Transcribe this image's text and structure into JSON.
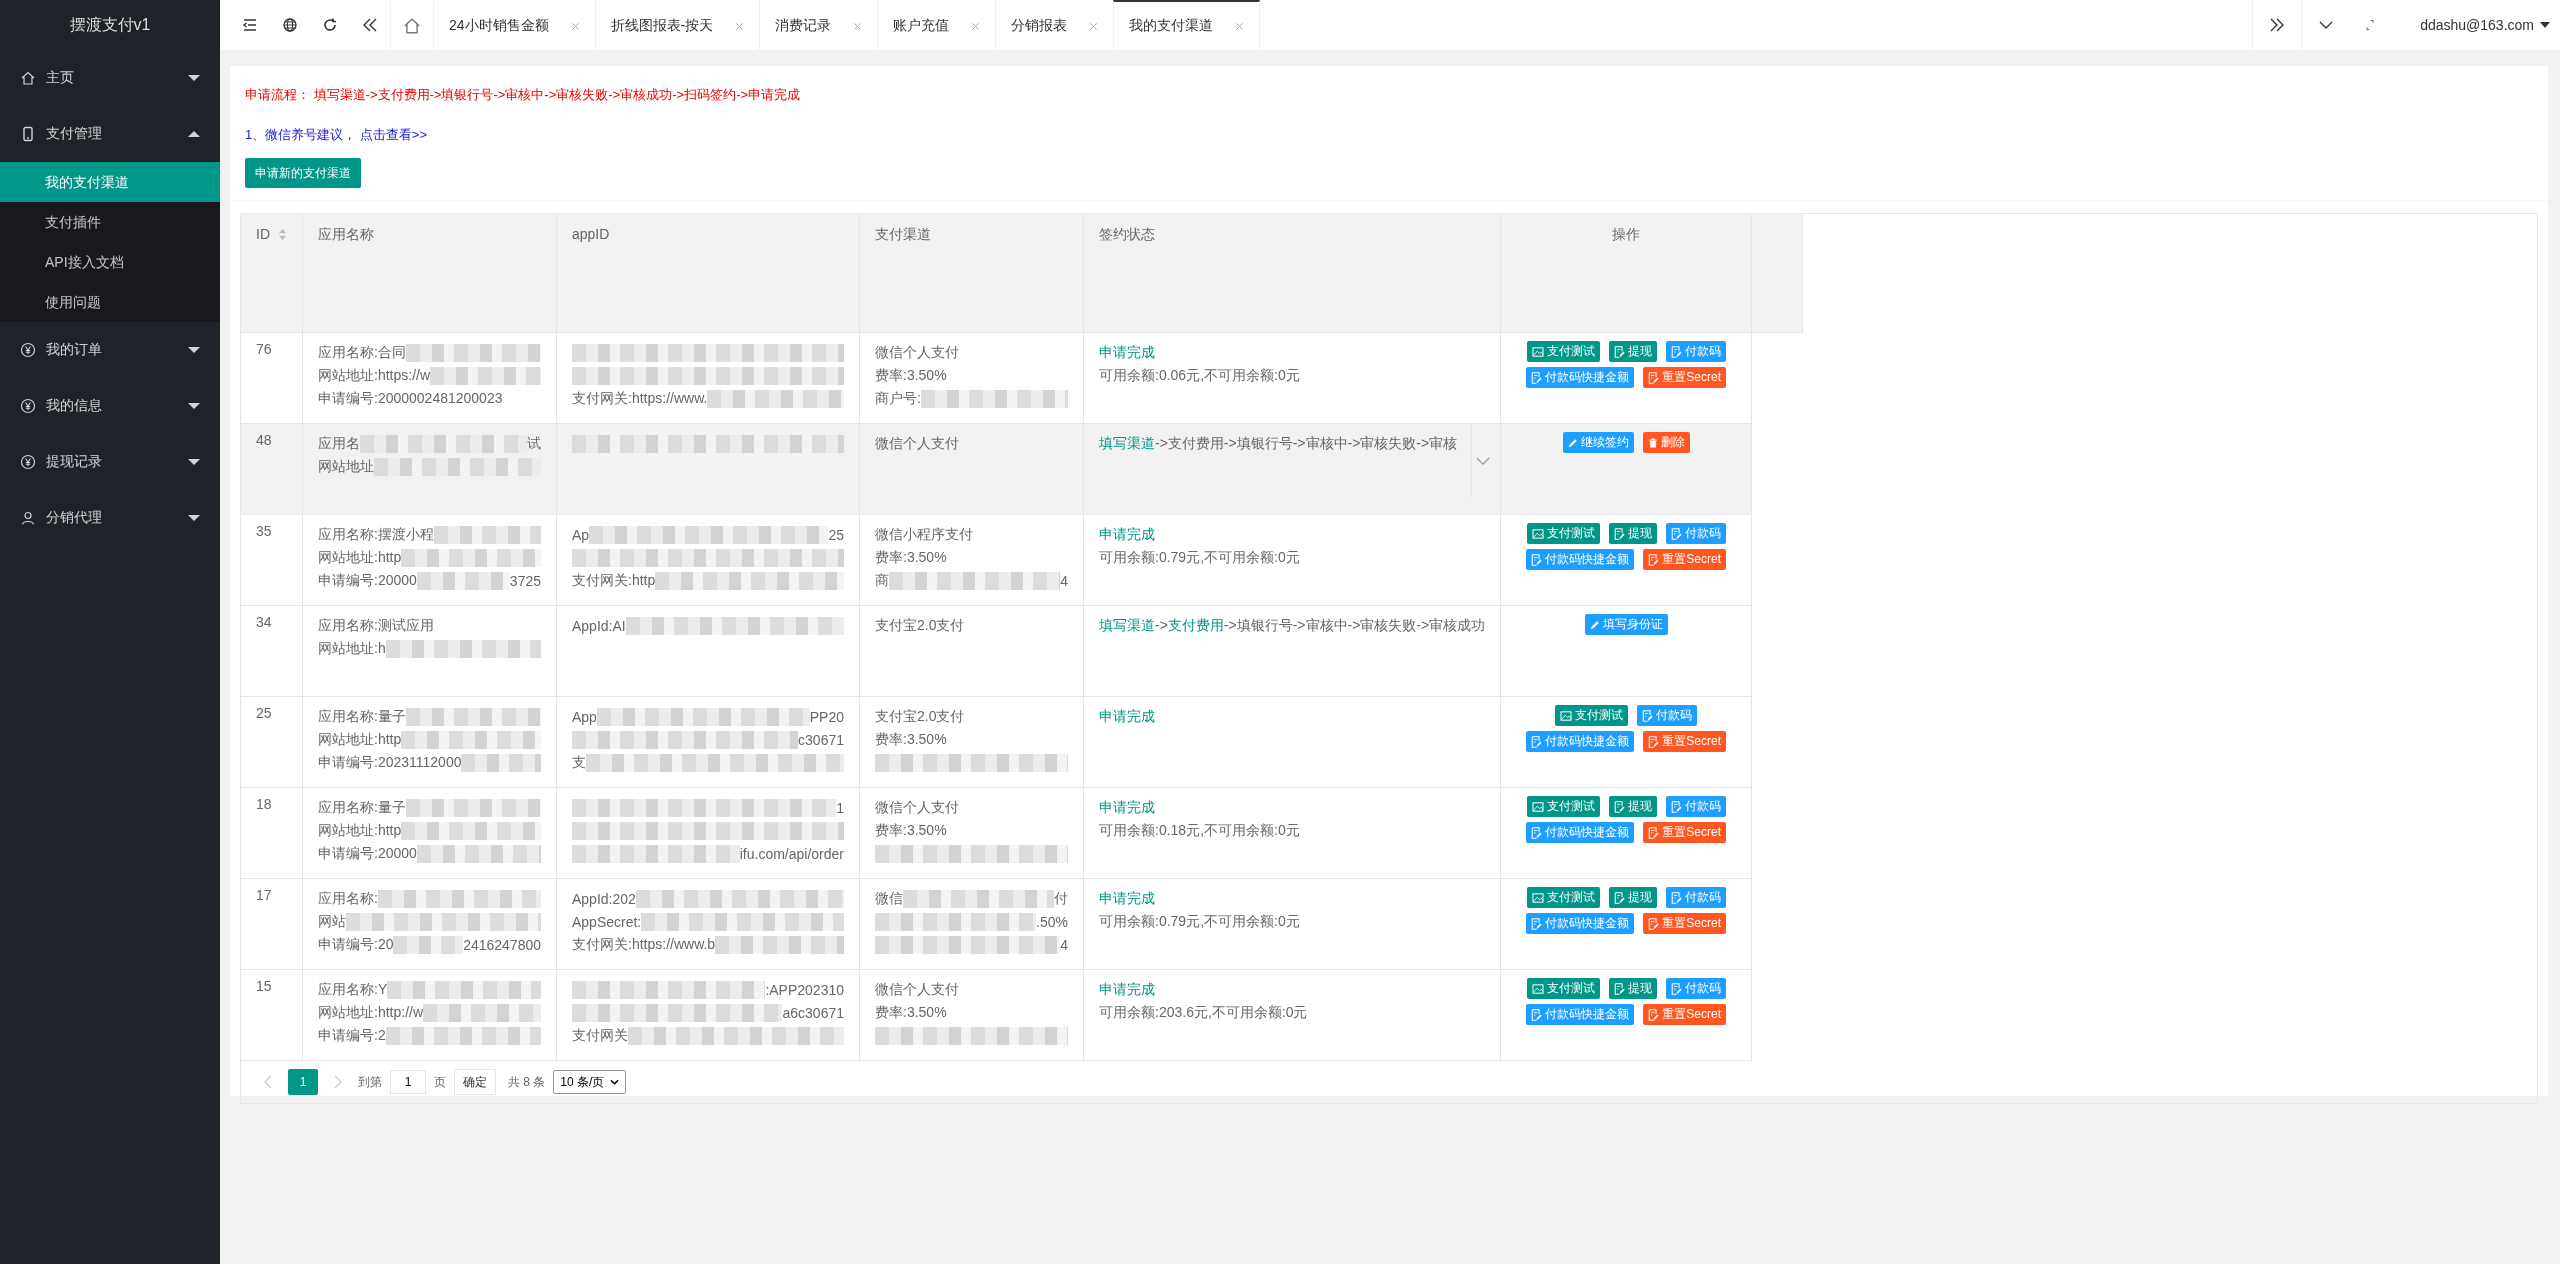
{
  "sidebar": {
    "title": "摆渡支付v1",
    "items": [
      {
        "kind": "home",
        "label": "主页",
        "expanded": false
      },
      {
        "kind": "phone",
        "label": "支付管理",
        "expanded": true,
        "children": [
          {
            "label": "我的支付渠道",
            "selected": true
          },
          {
            "label": "支付插件",
            "selected": false
          },
          {
            "label": "API接入文档",
            "selected": false
          },
          {
            "label": "使用问题",
            "selected": false
          }
        ]
      },
      {
        "kind": "yen",
        "label": "我的订单",
        "expanded": false
      },
      {
        "kind": "yen",
        "label": "我的信息",
        "expanded": false
      },
      {
        "kind": "yen",
        "label": "提现记录",
        "expanded": false
      },
      {
        "kind": "user",
        "label": "分销代理",
        "expanded": false
      }
    ]
  },
  "tabs": [
    {
      "kind": "home",
      "selected": false
    },
    {
      "kind": "page",
      "label": "24小时销售金额",
      "selected": false
    },
    {
      "kind": "page",
      "label": "折线图报表-按天",
      "selected": false
    },
    {
      "kind": "page",
      "label": "消费记录",
      "selected": false
    },
    {
      "kind": "page",
      "label": "账户充值",
      "selected": false
    },
    {
      "kind": "page",
      "label": "分销报表",
      "selected": false
    },
    {
      "kind": "page",
      "label": "我的支付渠道",
      "selected": true
    }
  ],
  "user": "ddashu@163.com",
  "notice": "申请流程： 填写渠道->支付费用->填银行号->审核中->审核失败->审核成功->扫码签约->申请完成",
  "tip": "1、微信养号建议， 点击查看>>",
  "apply_button": "申请新的支付渠道",
  "table": {
    "columns": [
      "ID",
      "应用名称",
      "appID",
      "支付渠道",
      "签约状态",
      "操作"
    ],
    "rows": [
      {
        "id": "76",
        "highlighted": false,
        "name": [
          {
            "text": "应用名称:合同",
            "blur": true
          },
          {
            "text": "网站地址:https://w",
            "blur": true
          },
          {
            "text": "申请编号:2000002481200023",
            "blur": false
          }
        ],
        "appid": [
          {
            "blur": true
          },
          {
            "blur": true
          },
          {
            "text": "支付网关:https://www.",
            "blur": true
          }
        ],
        "channel": [
          {
            "text": "微信个人支付",
            "blur": false
          },
          {
            "text": "费率:3.50%",
            "blur": false
          },
          {
            "text": "商户号:",
            "blur": true
          }
        ],
        "status": {
          "kind": "done",
          "text": "申请完成",
          "balance": "可用余额:0.06元,不可用余额:0元"
        },
        "actions": [
          {
            "kind": "test",
            "label": "支付测试",
            "color": "#009688"
          },
          {
            "kind": "withdraw",
            "label": "提现",
            "color": "#009688"
          },
          {
            "kind": "qrcode",
            "label": "付款码",
            "color": "#1e9fff"
          },
          {
            "kind": "quick",
            "label": "付款码快捷金额",
            "color": "#1e9fff"
          },
          {
            "kind": "reset",
            "label": "重置Secret",
            "color": "#ff5722"
          }
        ]
      },
      {
        "id": "48",
        "highlighted": true,
        "name": [
          {
            "text": "应用名",
            "blur": true,
            "tail": "试"
          },
          {
            "text": "网站地址",
            "blur": true
          }
        ],
        "appid": [
          {
            "blur": true
          }
        ],
        "channel": [
          {
            "text": "微信个人支付",
            "blur": false
          }
        ],
        "status": {
          "kind": "flow",
          "expander": true,
          "steps": [
            {
              "text": "填写渠道",
              "done": true
            },
            {
              "text": "->",
              "done": false
            },
            {
              "text": "支付费用",
              "done": false
            },
            {
              "text": "->填银行号->审核中->审核失败->审核",
              "done": false
            }
          ]
        },
        "actions": [
          {
            "kind": "continue",
            "label": "继续签约",
            "color": "#1e9fff"
          },
          {
            "kind": "delete",
            "label": "删除",
            "color": "#ff5722"
          }
        ]
      },
      {
        "id": "35",
        "highlighted": false,
        "name": [
          {
            "text": "应用名称:摆渡小程",
            "blur": true
          },
          {
            "text": "网站地址:http",
            "blur": true
          },
          {
            "text": "申请编号:20000",
            "blur": true,
            "tail": "3725"
          }
        ],
        "appid": [
          {
            "text": "Ap",
            "blur": true,
            "tail": "25"
          },
          {
            "blur": true
          },
          {
            "text": "支付网关:http",
            "blur": true
          }
        ],
        "channel": [
          {
            "text": "微信小程序支付",
            "blur": false
          },
          {
            "text": "费率:3.50%",
            "blur": false
          },
          {
            "text": "商",
            "blur": true,
            "tail": "4"
          }
        ],
        "status": {
          "kind": "done",
          "text": "申请完成",
          "balance": "可用余额:0.79元,不可用余额:0元"
        },
        "actions": [
          {
            "kind": "test",
            "label": "支付测试",
            "color": "#009688"
          },
          {
            "kind": "withdraw",
            "label": "提现",
            "color": "#009688"
          },
          {
            "kind": "qrcode",
            "label": "付款码",
            "color": "#1e9fff"
          },
          {
            "kind": "quick",
            "label": "付款码快捷金额",
            "color": "#1e9fff"
          },
          {
            "kind": "reset",
            "label": "重置Secret",
            "color": "#ff5722"
          }
        ]
      },
      {
        "id": "34",
        "highlighted": false,
        "name": [
          {
            "text": "应用名称:测试应用",
            "blur": false
          },
          {
            "text": "网站地址:h",
            "blur": true
          }
        ],
        "appid": [
          {
            "text": "AppId:AI",
            "blur": true
          }
        ],
        "channel": [
          {
            "text": "支付宝2.0支付",
            "blur": false
          }
        ],
        "status": {
          "kind": "flow",
          "expander": false,
          "steps": [
            {
              "text": "填写渠道",
              "done": true
            },
            {
              "text": "->",
              "done": false
            },
            {
              "text": "支付费用",
              "done": true
            },
            {
              "text": "->填银行号->审核中->审核失败->审核成功",
              "done": false
            }
          ]
        },
        "actions": [
          {
            "kind": "idcard",
            "label": "填写身份证",
            "color": "#1e9fff"
          }
        ]
      },
      {
        "id": "25",
        "highlighted": false,
        "name": [
          {
            "text": "应用名称:量子",
            "blur": true
          },
          {
            "text": "网站地址:http",
            "blur": true
          },
          {
            "text": "申请编号:20231112000",
            "blur": true
          }
        ],
        "appid": [
          {
            "text": "App",
            "blur": true,
            "tail": "PP20"
          },
          {
            "blur": true,
            "tail": "c30671"
          },
          {
            "text": "支",
            "blur": true
          }
        ],
        "channel": [
          {
            "text": "支付宝2.0支付",
            "blur": false
          },
          {
            "text": "费率:3.50%",
            "blur": false
          },
          {
            "blur": true
          }
        ],
        "status": {
          "kind": "done",
          "text": "申请完成"
        },
        "actions": [
          {
            "kind": "test",
            "label": "支付测试",
            "color": "#009688"
          },
          {
            "kind": "qrcode",
            "label": "付款码",
            "color": "#1e9fff"
          },
          {
            "kind": "quick",
            "label": "付款码快捷金额",
            "color": "#1e9fff"
          },
          {
            "kind": "reset",
            "label": "重置Secret",
            "color": "#ff5722"
          }
        ]
      },
      {
        "id": "18",
        "highlighted": false,
        "name": [
          {
            "text": "应用名称:量子",
            "blur": true
          },
          {
            "text": "网站地址:http",
            "blur": true
          },
          {
            "text": "申请编号:20000",
            "blur": true
          }
        ],
        "appid": [
          {
            "blur": true,
            "tail": "1"
          },
          {
            "blur": true
          },
          {
            "blur": true,
            "tail": "ifu.com/api/order"
          }
        ],
        "channel": [
          {
            "text": "微信个人支付",
            "blur": false
          },
          {
            "text": "费率:3.50%",
            "blur": false
          },
          {
            "blur": true
          }
        ],
        "status": {
          "kind": "done",
          "text": "申请完成",
          "balance": "可用余额:0.18元,不可用余额:0元"
        },
        "actions": [
          {
            "kind": "test",
            "label": "支付测试",
            "color": "#009688"
          },
          {
            "kind": "withdraw",
            "label": "提现",
            "color": "#009688"
          },
          {
            "kind": "qrcode",
            "label": "付款码",
            "color": "#1e9fff"
          },
          {
            "kind": "quick",
            "label": "付款码快捷金额",
            "color": "#1e9fff"
          },
          {
            "kind": "reset",
            "label": "重置Secret",
            "color": "#ff5722"
          }
        ]
      },
      {
        "id": "17",
        "highlighted": false,
        "name": [
          {
            "text": "应用名称:",
            "blur": true
          },
          {
            "text": "网站",
            "blur": true
          },
          {
            "text": "申请编号:20",
            "blur": true,
            "tail": "2416247800"
          }
        ],
        "appid": [
          {
            "text": "AppId:202",
            "blur": true
          },
          {
            "text": "AppSecret:",
            "blur": true
          },
          {
            "text": "支付网关:https://www.b",
            "blur": true
          }
        ],
        "channel": [
          {
            "text": "微信",
            "blur": true,
            "tail": "付"
          },
          {
            "blur": true,
            "tail": ".50%"
          },
          {
            "blur": true,
            "tail": "4"
          }
        ],
        "status": {
          "kind": "done",
          "text": "申请完成",
          "balance": "可用余额:0.79元,不可用余额:0元"
        },
        "actions": [
          {
            "kind": "test",
            "label": "支付测试",
            "color": "#009688"
          },
          {
            "kind": "withdraw",
            "label": "提现",
            "color": "#009688"
          },
          {
            "kind": "qrcode",
            "label": "付款码",
            "color": "#1e9fff"
          },
          {
            "kind": "quick",
            "label": "付款码快捷金额",
            "color": "#1e9fff"
          },
          {
            "kind": "reset",
            "label": "重置Secret",
            "color": "#ff5722"
          }
        ]
      },
      {
        "id": "15",
        "highlighted": false,
        "name": [
          {
            "text": "应用名称:Y",
            "blur": true
          },
          {
            "text": "网站地址:http://w",
            "blur": true
          },
          {
            "text": "申请编号:2",
            "blur": true
          }
        ],
        "appid": [
          {
            "blur": true,
            "tail": ":APP202310"
          },
          {
            "blur": true,
            "tail": "a6c30671"
          },
          {
            "text": "支付网关",
            "blur": true
          }
        ],
        "channel": [
          {
            "text": "微信个人支付",
            "blur": false
          },
          {
            "text": "费率:3.50%",
            "blur": false
          },
          {
            "blur": true
          }
        ],
        "status": {
          "kind": "done",
          "text": "申请完成",
          "balance": "可用余额:203.6元,不可用余额:0元"
        },
        "actions": [
          {
            "kind": "test",
            "label": "支付测试",
            "color": "#009688"
          },
          {
            "kind": "withdraw",
            "label": "提现",
            "color": "#009688"
          },
          {
            "kind": "qrcode",
            "label": "付款码",
            "color": "#1e9fff"
          },
          {
            "kind": "quick",
            "label": "付款码快捷金额",
            "color": "#1e9fff"
          },
          {
            "kind": "reset",
            "label": "重置Secret",
            "color": "#ff5722"
          }
        ]
      }
    ]
  },
  "pagination": {
    "pages": [
      {
        "label": "1",
        "selected": true
      }
    ],
    "goto_label": "到第",
    "goto_value": "1",
    "page_unit": "页",
    "confirm": "确定",
    "total": "共 8 条",
    "page_size": "10 条/页"
  }
}
